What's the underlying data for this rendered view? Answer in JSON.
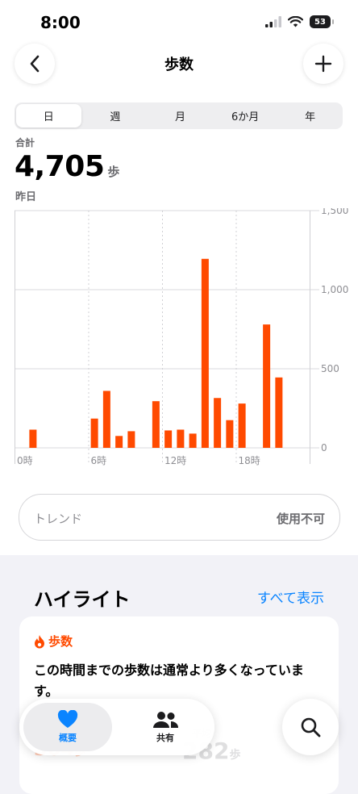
{
  "status": {
    "time": "8:00",
    "battery": "53"
  },
  "nav": {
    "title": "歩数"
  },
  "segments": [
    "日",
    "週",
    "月",
    "6か月",
    "年"
  ],
  "summary": {
    "label": "合計",
    "value": "4,705",
    "unit": "歩",
    "date": "昨日"
  },
  "trend": {
    "label": "トレンド",
    "value": "使用不可"
  },
  "highlights": {
    "title": "ハイライト",
    "show_all": "すべて表示",
    "card_title": "歩数",
    "text": "この時間までの歩数は通常より多くなっています。",
    "stat_a_value": "304",
    "stat_a_unit": "歩",
    "stat_b_label": "平均",
    "stat_b_value": "282",
    "stat_b_unit": "歩"
  },
  "tabbar": {
    "summary_label": "概要",
    "sharing_label": "共有"
  },
  "colors": {
    "accent": "#ff4a00",
    "link": "#0a84ff"
  },
  "chart_data": {
    "type": "bar",
    "x_tick_labels": [
      "0時",
      "6時",
      "12時",
      "18時"
    ],
    "y_tick_labels": [
      "0",
      "500",
      "1,000",
      "1,500"
    ],
    "ylim": [
      0,
      1500
    ],
    "x": [
      1,
      6,
      7,
      8,
      9,
      11,
      12,
      13,
      14,
      15,
      16,
      17,
      18,
      20,
      21
    ],
    "values": [
      115,
      185,
      360,
      75,
      105,
      295,
      110,
      115,
      90,
      1195,
      315,
      175,
      280,
      780,
      445
    ]
  }
}
